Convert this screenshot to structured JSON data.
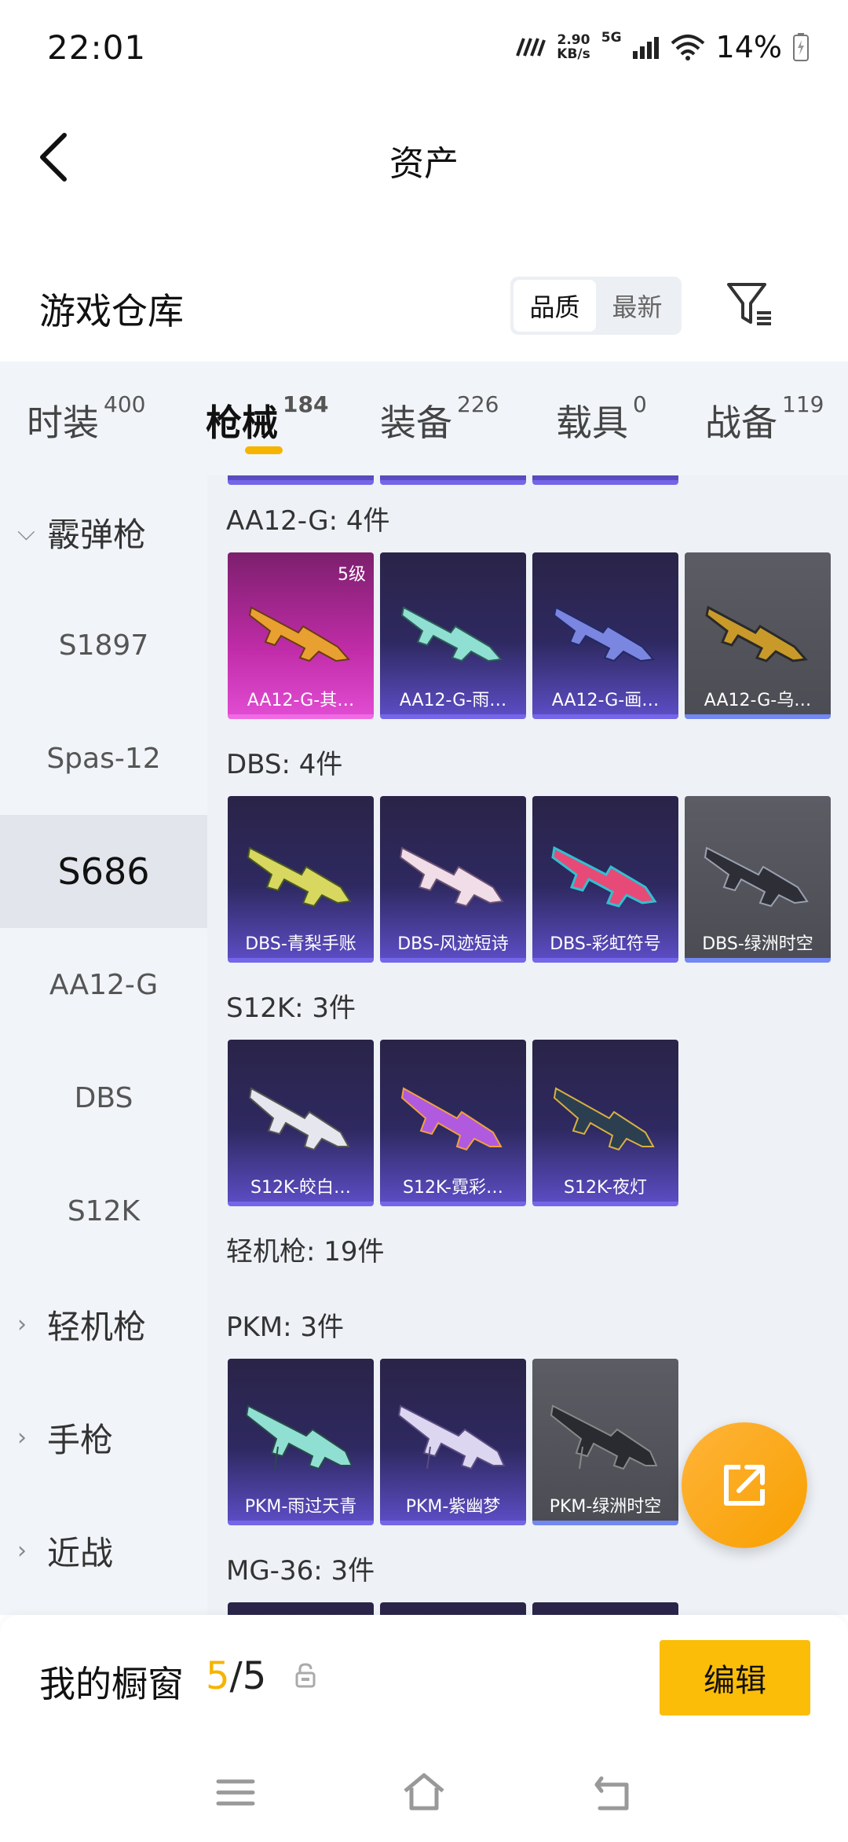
{
  "status": {
    "time": "22:01",
    "speed_value": "2.90",
    "speed_unit": "KB/s",
    "network": "5G",
    "battery": "14%"
  },
  "header": {
    "title": "资产"
  },
  "warehouse": {
    "label": "游戏仓库",
    "sort_quality": "品质",
    "sort_newest": "最新"
  },
  "tabs": [
    {
      "label": "时装",
      "count": "400"
    },
    {
      "label": "枪械",
      "count": "184"
    },
    {
      "label": "装备",
      "count": "226"
    },
    {
      "label": "载具",
      "count": "0"
    },
    {
      "label": "战备",
      "count": "119"
    }
  ],
  "sidebar": {
    "group_shotgun": "霰弹枪",
    "items": [
      "S1897",
      "Spas-12",
      "S686",
      "AA12-G",
      "DBS",
      "S12K"
    ],
    "group_lmg": "轻机枪",
    "group_pistol": "手枪",
    "group_melee": "近战"
  },
  "sections": {
    "aa12": {
      "title": "AA12-G: 4件",
      "cards": [
        "AA12-G-其…",
        "AA12-G-雨…",
        "AA12-G-画…",
        "AA12-G-乌…"
      ],
      "level": "5级"
    },
    "dbs": {
      "title": "DBS: 4件",
      "cards": [
        "DBS-青梨手账",
        "DBS-风迹短诗",
        "DBS-彩虹符号",
        "DBS-绿洲时空"
      ]
    },
    "s12k": {
      "title": "S12K: 3件",
      "cards": [
        "S12K-皎白…",
        "S12K-霓彩…",
        "S12K-夜灯"
      ]
    },
    "lmg_header": "轻机枪: 19件",
    "pkm": {
      "title": "PKM: 3件",
      "cards": [
        "PKM-雨过天青",
        "PKM-紫幽梦",
        "PKM-绿洲时空"
      ]
    },
    "mg36": {
      "title": "MG-36: 3件"
    }
  },
  "showcase": {
    "label": "我的橱窗",
    "current": "5",
    "total": "/5",
    "edit": "编辑"
  },
  "colors": {
    "accent": "#f5b400",
    "card_purple": "#2e2960",
    "card_gold": "#c02ca8",
    "card_gray": "#4c4d54"
  }
}
